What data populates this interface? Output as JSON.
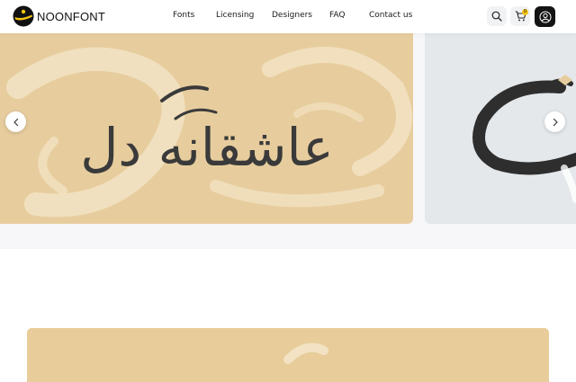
{
  "brand": {
    "name": "NOONFONT"
  },
  "nav": {
    "items": [
      {
        "label": "Fonts"
      },
      {
        "label": "Licensing"
      },
      {
        "label": "Designers"
      },
      {
        "label": "FAQ"
      },
      {
        "label": "Contact us"
      }
    ]
  },
  "header_actions": {
    "search_icon": "search-icon",
    "cart_icon": "cart-icon",
    "cart_count": "0",
    "account_icon": "user-icon"
  },
  "carousel": {
    "slides": [
      {
        "text": "عاشقانه دل",
        "background": "#e7cd9e",
        "ink": "#3a3a3a"
      },
      {
        "background": "#e4e8eb",
        "ink": "#2e2e2e"
      }
    ],
    "prev_icon": "chevron-left-icon",
    "next_icon": "chevron-right-icon"
  },
  "colors": {
    "accent": "#f3c315",
    "dark": "#141414",
    "sand": "#e7cd9e"
  }
}
